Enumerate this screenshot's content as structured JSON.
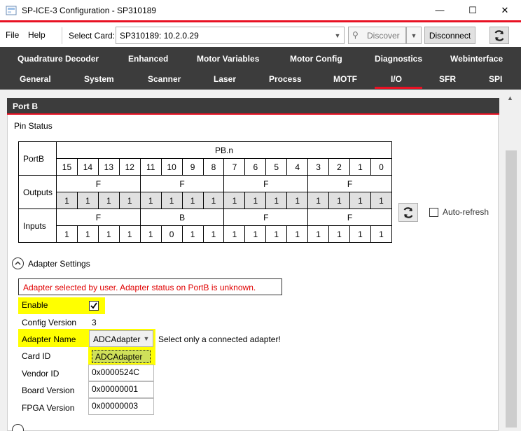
{
  "window": {
    "title": "SP-ICE-3 Configuration - SP310189"
  },
  "menu": {
    "file": "File",
    "help": "Help"
  },
  "toolbar": {
    "select_card_label": "Select Card:",
    "card_value": "SP310189: 10.2.0.29",
    "discover_label": "Discover",
    "disconnect_label": "Disconnect"
  },
  "tabs_row1": [
    "Quadrature Decoder",
    "Enhanced",
    "Motor Variables",
    "Motor Config",
    "Diagnostics",
    "Webinterface"
  ],
  "tabs_row2": [
    "General",
    "System",
    "Scanner",
    "Laser",
    "Process",
    "MOTF",
    "I/O",
    "SFR",
    "SPI"
  ],
  "active_tab": "I/O",
  "panel": {
    "title": "Port B",
    "pin_status": "Pin Status"
  },
  "pin_table": {
    "row_port": "PortB",
    "header": "PB.n",
    "bits": [
      "15",
      "14",
      "13",
      "12",
      "11",
      "10",
      "9",
      "8",
      "7",
      "6",
      "5",
      "4",
      "3",
      "2",
      "1",
      "0"
    ],
    "outputs_label": "Outputs",
    "outputs_hex": [
      "F",
      "F",
      "F",
      "F"
    ],
    "outputs_bits": [
      "1",
      "1",
      "1",
      "1",
      "1",
      "1",
      "1",
      "1",
      "1",
      "1",
      "1",
      "1",
      "1",
      "1",
      "1",
      "1"
    ],
    "inputs_label": "Inputs",
    "inputs_hex": [
      "F",
      "B",
      "F",
      "F"
    ],
    "inputs_bits": [
      "1",
      "1",
      "1",
      "1",
      "1",
      "0",
      "1",
      "1",
      "1",
      "1",
      "1",
      "1",
      "1",
      "1",
      "1",
      "1"
    ]
  },
  "auto_refresh_label": "Auto-refresh",
  "adapter": {
    "section_label": "Adapter Settings",
    "warning": "Adapter selected by user. Adapter status on PortB is unknown.",
    "enable_label": "Enable",
    "enable_checked": true,
    "config_version_label": "Config Version",
    "config_version_value": "3",
    "adapter_name_label": "Adapter Name",
    "adapter_name_value": "ADCAdapter",
    "adapter_hint": "Select only a connected adapter!",
    "card_id_label": "Card ID",
    "card_id_value": "ADCAdapter",
    "vendor_id_label": "Vendor ID",
    "vendor_id_value": "0x0000524C",
    "board_version_label": "Board Version",
    "board_version_value": "0x00000001",
    "fpga_version_label": "FPGA Version",
    "fpga_version_value": "0x00000003"
  },
  "colors": {
    "accent": "#e81123",
    "tab_bg": "#3c3c3c",
    "highlight": "#ffff00",
    "warning_text": "#e00000"
  }
}
